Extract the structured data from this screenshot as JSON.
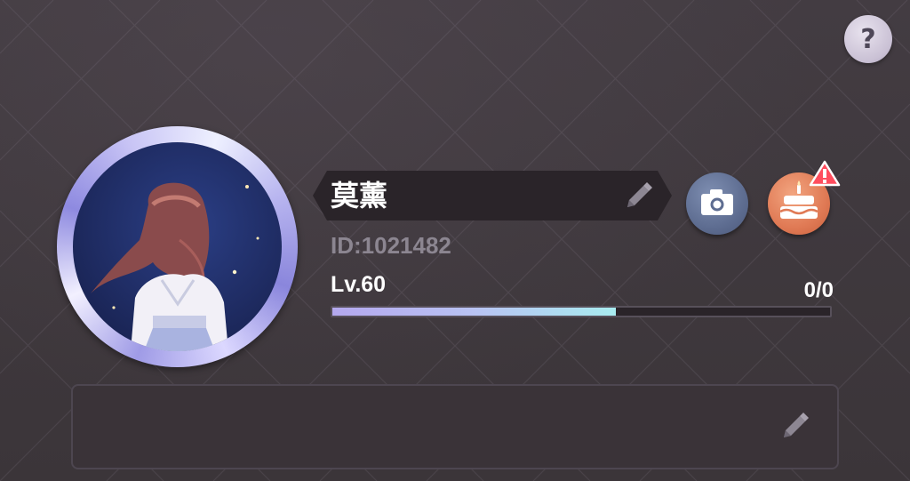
{
  "help": {
    "symbol": "?",
    "icon": "question-icon"
  },
  "profile": {
    "name": "莫薰",
    "id_text": "ID:1021482",
    "level_text": "Lv.60",
    "exp_text": "0/0",
    "exp_progress": 0.57
  },
  "actions": {
    "camera_icon": "camera-icon",
    "birthday_icon": "cake-icon",
    "birthday_badge": "!"
  },
  "bio": {
    "text": ""
  },
  "colors": {
    "accent": "#b4a8ee",
    "bar_end": "#a8ecf0",
    "birthday_button": "#e07a55",
    "camera_button": "#5e6d91",
    "alert_badge": "#ff4d5e"
  }
}
